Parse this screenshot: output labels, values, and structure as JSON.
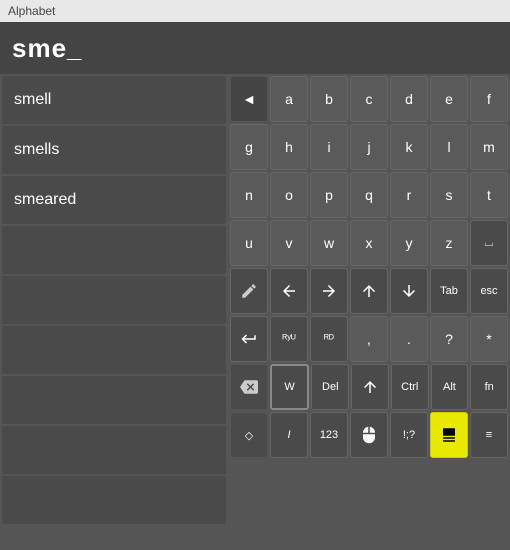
{
  "title": "Alphabet",
  "search": {
    "text": "sme_"
  },
  "suggestions": [
    {
      "label": "smell",
      "empty": false
    },
    {
      "label": "smells",
      "empty": false
    },
    {
      "label": "smeared",
      "empty": false
    },
    {
      "label": "",
      "empty": true
    },
    {
      "label": "",
      "empty": true
    },
    {
      "label": "",
      "empty": true
    },
    {
      "label": "",
      "empty": true
    },
    {
      "label": "",
      "empty": true
    },
    {
      "label": "",
      "empty": true
    }
  ],
  "keyboard": {
    "rows": [
      [
        "◄",
        "a",
        "b",
        "c",
        "d",
        "e",
        "f"
      ],
      [
        "g",
        "h",
        "i",
        "j",
        "k",
        "l",
        "m"
      ],
      [
        "n",
        "o",
        "p",
        "q",
        "r",
        "s",
        "t"
      ],
      [
        "u",
        "v",
        "w",
        "x",
        "y",
        "z",
        "⌴"
      ],
      [
        "✏",
        "←",
        "→",
        "↑",
        "↓",
        "Tab",
        "esc"
      ],
      [
        "↵",
        "ᴿʸᵁ",
        "ᴿᴰ",
        ",",
        ".",
        "?",
        "*"
      ],
      [
        "⌫",
        "W",
        "Del",
        "↑",
        "Ctrl",
        "Alt",
        "fn"
      ],
      [
        "◇",
        "I",
        "123",
        "🖱",
        "!;?",
        "⬚",
        "≡"
      ]
    ],
    "special_keys": {
      "backspace": "⌫",
      "space": "⌴",
      "enter": "↵"
    }
  },
  "icons": {
    "pencil": "✏",
    "left_arrow": "←",
    "right_arrow": "→",
    "up_arrow": "↑",
    "down_arrow": "↓",
    "back_arrow": "◄",
    "undo": "↩",
    "delete_back": "⌫"
  },
  "highlight_key": "⬚"
}
